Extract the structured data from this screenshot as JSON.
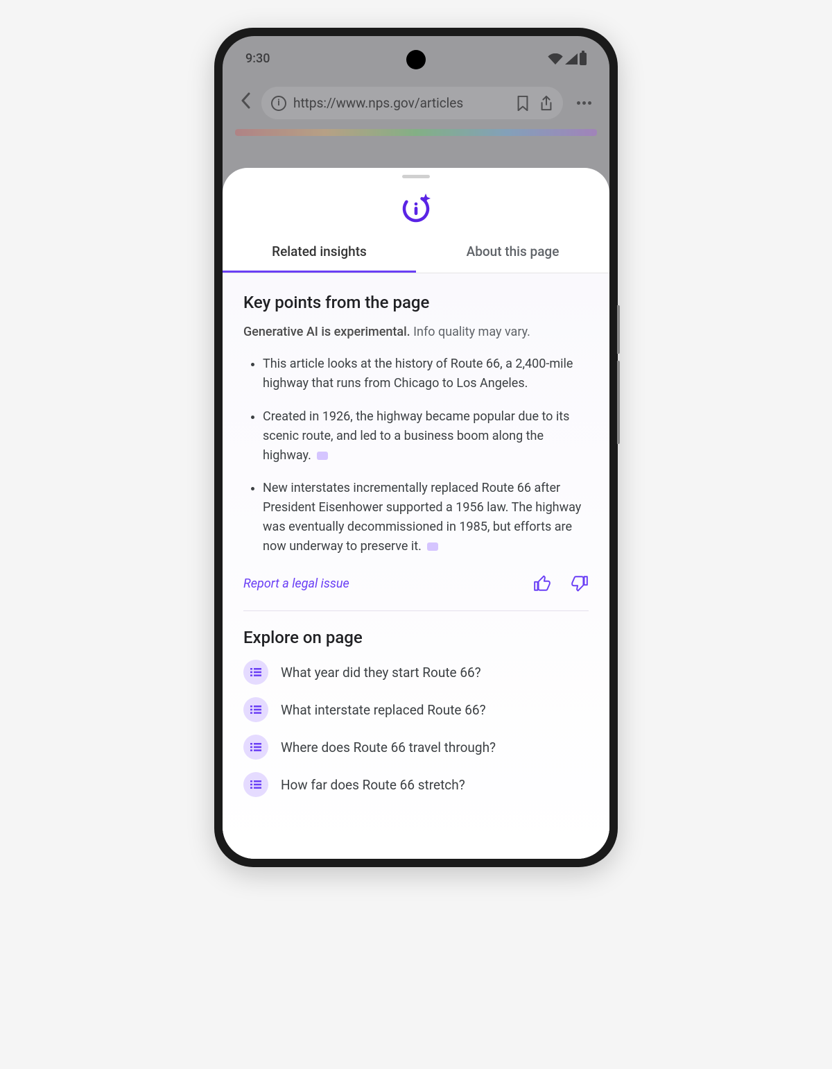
{
  "status": {
    "time": "9:30"
  },
  "browser": {
    "url": "https://www.nps.gov/articles"
  },
  "sheet": {
    "tabs": {
      "insights": "Related insights",
      "about": "About this page"
    },
    "keyPoints": {
      "title": "Key points from the page",
      "disclaimerBold": "Generative AI is experimental.",
      "disclaimerRest": " Info quality may vary.",
      "bullets": [
        "This article looks at the history of Route 66, a 2,400-mile highway that runs from Chicago to Los Angeles.",
        "Created in 1926, the highway became popular due to its scenic route, and led to a business boom along the highway.",
        "New interstates incrementally replaced Route 66 after President Eisenhower supported a 1956 law. The highway was eventually decommissioned in 1985, but efforts are now underway to preserve it."
      ]
    },
    "legalLink": "Report a legal issue",
    "explore": {
      "title": "Explore on page",
      "items": [
        "What year did they start Route 66?",
        "What interstate replaced Route 66?",
        "Where does Route 66 travel through?",
        "How far does Route 66 stretch?"
      ]
    }
  }
}
